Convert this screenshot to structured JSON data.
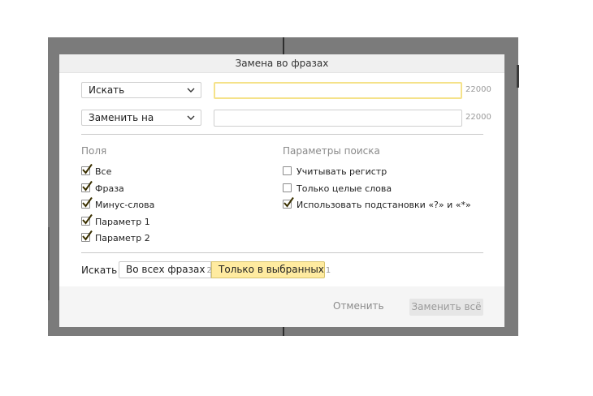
{
  "dialog": {
    "title": "Замена во фразах"
  },
  "search_row": {
    "mode_label": "Искать",
    "value": "",
    "limit": "22000"
  },
  "replace_row": {
    "mode_label": "Заменить на",
    "value": "",
    "limit": "22000"
  },
  "fields": {
    "title": "Поля",
    "items": [
      {
        "label": "Все",
        "checked": true
      },
      {
        "label": "Фраза",
        "checked": true
      },
      {
        "label": "Минус-слова",
        "checked": true
      },
      {
        "label": "Параметр 1",
        "checked": true
      },
      {
        "label": "Параметр 2",
        "checked": true
      }
    ]
  },
  "search_params": {
    "title": "Параметры поиска",
    "items": [
      {
        "label": "Учитывать регистр",
        "checked": false
      },
      {
        "label": "Только целые слова",
        "checked": false
      },
      {
        "label": "Использовать подстановки «?» и «*»",
        "checked": true
      }
    ]
  },
  "scope": {
    "label": "Искать",
    "options": [
      {
        "label": "Во всех фразах",
        "count": "2",
        "selected": false
      },
      {
        "label": "Только в выбранных",
        "count": "1",
        "selected": true
      }
    ]
  },
  "footer": {
    "cancel_label": "Отменить",
    "replace_all_label": "Заменить всё"
  },
  "colors": {
    "accent": "#ffeba0",
    "focus_border": "#f5e28a",
    "check_mark": "#3a3000",
    "overlay": "#7b7b7b"
  }
}
